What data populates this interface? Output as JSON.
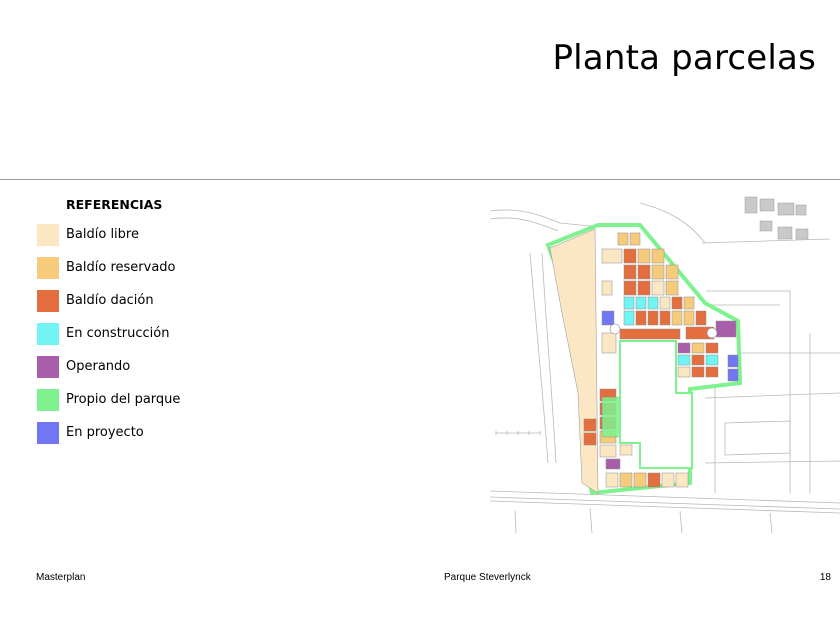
{
  "page": {
    "title": "Planta parcelas"
  },
  "legend": {
    "heading": "REFERENCIAS",
    "items": [
      {
        "label": "Baldío libre",
        "color": "#fbe7c4"
      },
      {
        "label": "Baldío reservado",
        "color": "#f6cb7c"
      },
      {
        "label": "Baldío dación",
        "color": "#e46e3e"
      },
      {
        "label": "En construcción",
        "color": "#72f4f4"
      },
      {
        "label": "Operando",
        "color": "#a85ea8"
      },
      {
        "label": "Propio del parque",
        "color": "#7ef28e"
      },
      {
        "label": "En proyecto",
        "color": "#7176f2"
      }
    ]
  },
  "footer": {
    "left": "Masterplan",
    "center": "Parque Steverlynck",
    "page_number": "18"
  }
}
